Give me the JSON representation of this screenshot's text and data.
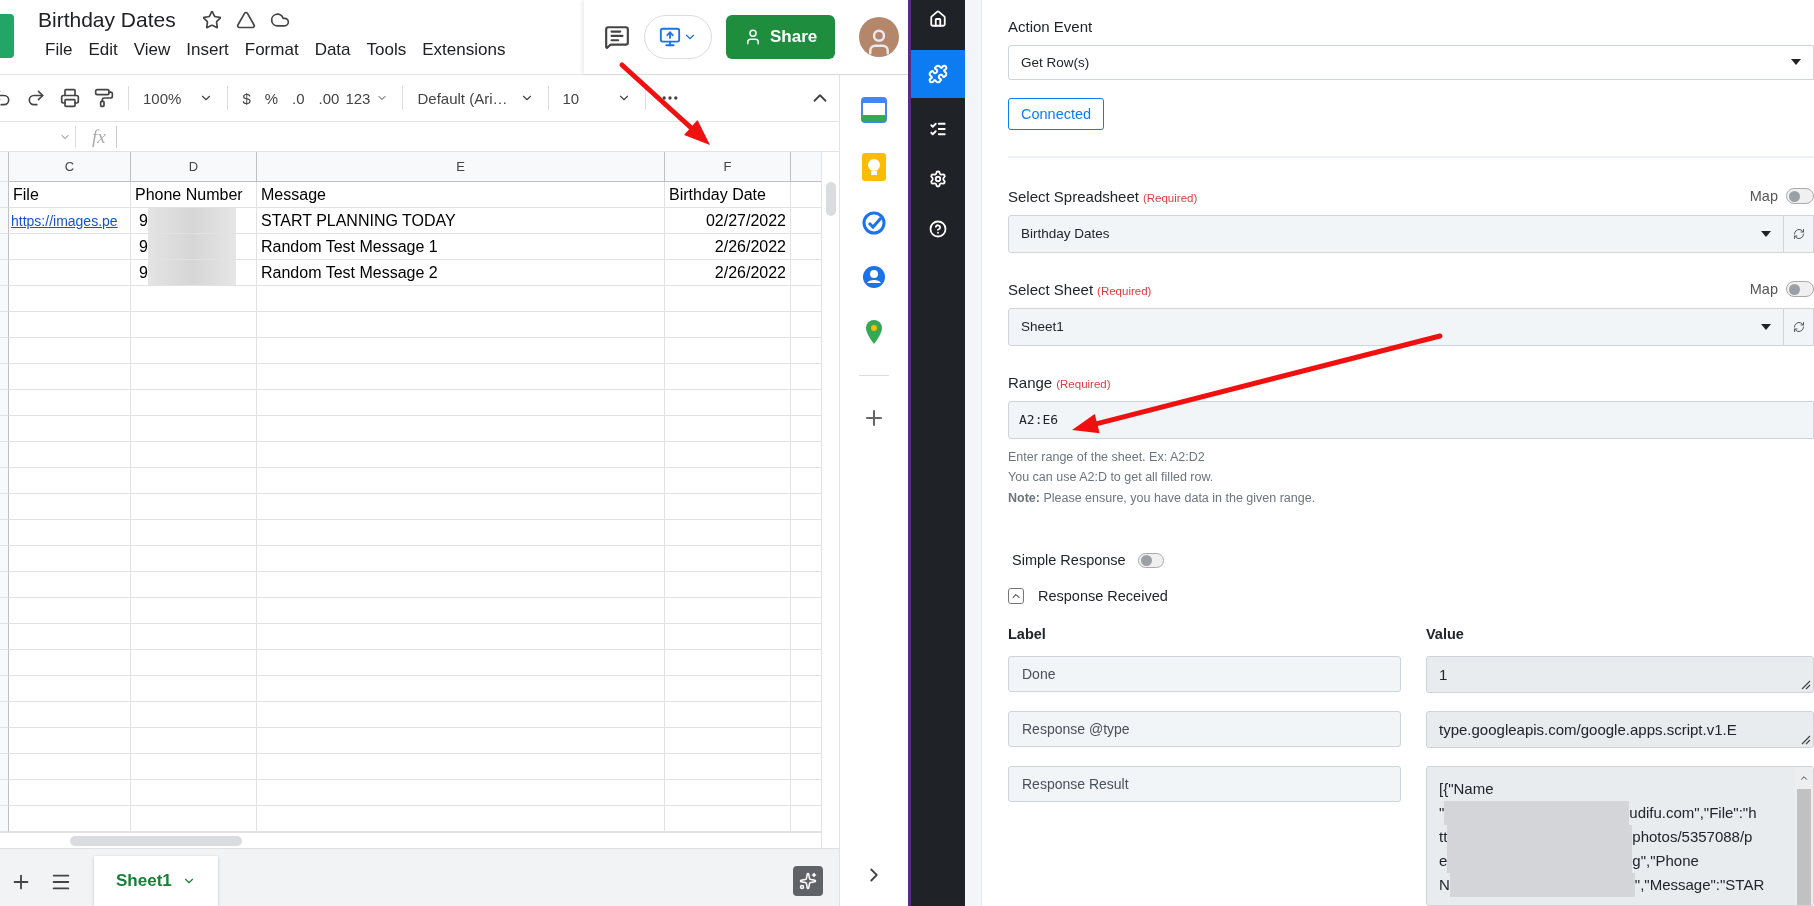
{
  "sheets": {
    "title": "Birthday Dates",
    "menu": [
      "File",
      "Edit",
      "View",
      "Insert",
      "Format",
      "Data",
      "Tools",
      "Extensions"
    ],
    "share_button": "Share",
    "toolbar": {
      "zoom": "100%",
      "currency": "$",
      "percent": "%",
      "decrease_decimals": ".0",
      "increase_decimals": ".00",
      "number_format": "123",
      "font": "Default (Ari…",
      "font_size": "10"
    },
    "formula_bar": {
      "fx": "fx"
    },
    "columns": [
      "C",
      "D",
      "E",
      "F"
    ],
    "rows": [
      {
        "cells": [
          {
            "kind": "text",
            "text": "File"
          },
          {
            "kind": "text",
            "text": "Phone Number"
          },
          {
            "kind": "text",
            "text": "Message"
          },
          {
            "kind": "text",
            "text": "Birthday Date"
          }
        ]
      },
      {
        "cells": [
          {
            "kind": "link",
            "text": "https://images.pe"
          },
          {
            "kind": "redacted",
            "text": "9"
          },
          {
            "kind": "text",
            "text": "START PLANNING TODAY"
          },
          {
            "kind": "number",
            "text": "02/27/2022"
          }
        ]
      },
      {
        "cells": [
          {
            "kind": "text",
            "text": ""
          },
          {
            "kind": "redacted",
            "text": "9"
          },
          {
            "kind": "text",
            "text": "Random Test Message 1"
          },
          {
            "kind": "number",
            "text": "2/26/2022"
          }
        ]
      },
      {
        "cells": [
          {
            "kind": "text",
            "text": ""
          },
          {
            "kind": "redacted",
            "text": "9"
          },
          {
            "kind": "text",
            "text": "Random Test Message 2"
          },
          {
            "kind": "number",
            "text": "2/26/2022"
          }
        ]
      }
    ],
    "sheet_tabs": [
      {
        "label": "Sheet1",
        "selected": true
      }
    ]
  },
  "nav": [
    {
      "kind": "home",
      "selected": false
    },
    {
      "kind": "puzzle",
      "selected": true
    },
    {
      "kind": "tasks",
      "selected": false
    },
    {
      "kind": "settings",
      "selected": false
    },
    {
      "kind": "help",
      "selected": false
    }
  ],
  "form": {
    "action_event": {
      "label": "Action Event",
      "value": "Get Row(s)"
    },
    "status_button": "Connected",
    "fields": [
      {
        "kind": "select",
        "label": "Select Spreadsheet",
        "required": "(Required)",
        "value": "Birthday Dates",
        "map_label": "Map",
        "map_on": false
      },
      {
        "kind": "select",
        "label": "Select Sheet",
        "required": "(Required)",
        "value": "Sheet1",
        "map_label": "Map",
        "map_on": false
      },
      {
        "kind": "input",
        "label": "Range",
        "required": "(Required)",
        "value": "A2:E6"
      }
    ],
    "help": [
      "Enter range of the sheet. Ex: A2:D2",
      "You can use A2:D to get all filled row.",
      "**Note:** Please ensure, you have data in the given range."
    ],
    "simple_response": {
      "label": "Simple Response",
      "on": false
    },
    "response": {
      "title": "Response Received",
      "expanded": true,
      "label_header": "Label",
      "value_header": "Value",
      "rows": [
        {
          "label": "Done",
          "lines": [
            [
              {
                "kind": "text",
                "text": "1"
              }
            ]
          ]
        },
        {
          "label": "Response @type",
          "lines": [
            [
              {
                "kind": "text",
                "text": "type.googleapis.com/google.apps.script.v1.E"
              }
            ]
          ]
        },
        {
          "label": "Response Result",
          "lines": [
            [
              {
                "kind": "text",
                "text": "[{\"Name"
              }
            ],
            [
              {
                "kind": "text",
                "text": "\""
              },
              {
                "kind": "blur"
              },
              {
                "kind": "text",
                "text": "udifu.com\",\"File\":\"h"
              }
            ],
            [
              {
                "kind": "text",
                "text": "tt"
              },
              {
                "kind": "blur"
              },
              {
                "kind": "text",
                "text": "photos/5357088/p"
              }
            ],
            [
              {
                "kind": "text",
                "text": "e"
              },
              {
                "kind": "blur"
              },
              {
                "kind": "text",
                "text": "g\",\"Phone"
              }
            ],
            [
              {
                "kind": "text",
                "text": "N"
              },
              {
                "kind": "blur"
              },
              {
                "kind": "text",
                "text": "\",\"Message\":\"STAR"
              }
            ]
          ]
        }
      ]
    }
  }
}
